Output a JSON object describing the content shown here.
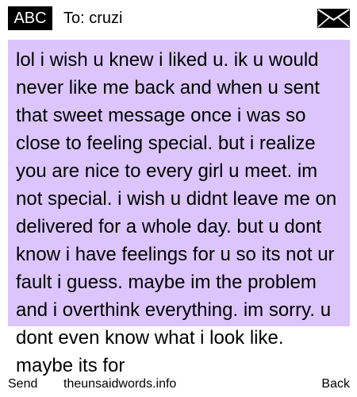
{
  "header": {
    "mode_badge": "ABC",
    "to_label": "To:",
    "recipient": "cruzi",
    "envelope_icon": "envelope-icon"
  },
  "message": {
    "text": "lol i wish u knew i liked u. ik u would never like me back and when u sent that sweet message once i was so close to feeling special. but i realize you are nice to every girl u meet. im not special. i wish u didnt leave me on delivered for a whole day. but u dont know i  have feelings for u so its not ur fault i guess. maybe im the problem and i overthink everything. im sorry. u dont even know what i look like. maybe its for",
    "background_color": "#dcc5fc"
  },
  "footer": {
    "left_softkey": "Send",
    "center": "theunsaidwords.info",
    "right_softkey": "Back"
  }
}
